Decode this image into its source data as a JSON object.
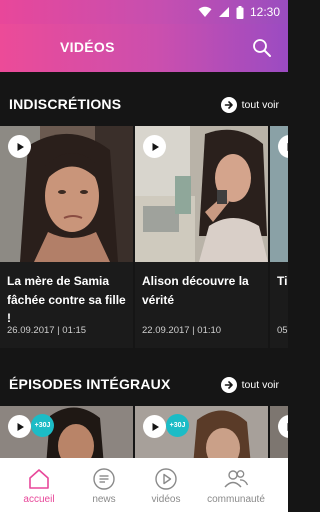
{
  "status_bar": {
    "time": "12:30"
  },
  "app_bar": {
    "title": "VIDÉOS"
  },
  "sections": [
    {
      "title": "INDISCRÉTIONS",
      "see_all": "tout voir",
      "cards": [
        {
          "title": "La mère de Samia fâchée contre sa fille !",
          "meta": "26.09.2017 | 01:15"
        },
        {
          "title": "Alison découvre la vérité",
          "meta": "22.09.2017 | 01:10"
        },
        {
          "title": "Ti",
          "meta": "05"
        }
      ]
    },
    {
      "title": "ÉPISODES INTÉGRAUX",
      "see_all": "tout voir",
      "cards": [
        {
          "badge": "+30J"
        },
        {
          "badge": "+30J"
        },
        {}
      ]
    }
  ],
  "bottom_nav": {
    "items": [
      {
        "label": "accueil",
        "icon": "home-icon",
        "active": true
      },
      {
        "label": "news",
        "icon": "news-icon",
        "active": false
      },
      {
        "label": "vidéos",
        "icon": "play-icon",
        "active": false
      },
      {
        "label": "communauté",
        "icon": "community-icon",
        "active": false
      }
    ]
  },
  "colors": {
    "brand_pink": "#e8479a",
    "brand_purple": "#9b4bc2",
    "badge_teal": "#1cbcc6",
    "background": "#151515"
  }
}
